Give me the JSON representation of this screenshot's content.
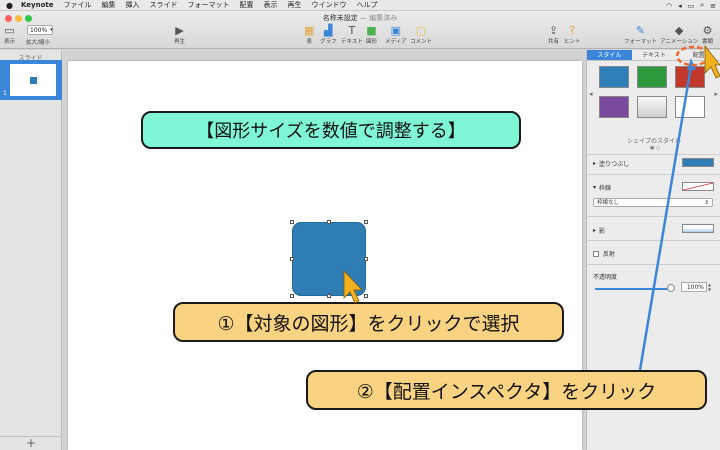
{
  "menubar": {
    "app_name": "Keynote",
    "items": [
      "ファイル",
      "編集",
      "挿入",
      "スライド",
      "フォーマット",
      "配置",
      "表示",
      "再生",
      "ウインドウ",
      "ヘルプ"
    ]
  },
  "toolbar": {
    "doc_title": "名称未設定",
    "doc_status": "— 編集済み",
    "zoom_value": "100%",
    "view_label": "表示",
    "zoom_label": "拡大/縮小",
    "play_label": "再生",
    "table_label": "表",
    "chart_label": "グラフ",
    "text_label": "テキスト",
    "shape_label": "図形",
    "media_label": "メディア",
    "comment_label": "コメント",
    "share_label": "共有",
    "tips_label": "ヒント",
    "format_label": "フォーマット",
    "animation_label": "アニメーション",
    "document_label": "書類"
  },
  "slide_panel": {
    "header": "スライド",
    "slide_number": "1",
    "add_label": "+"
  },
  "callouts": {
    "title": "【図形サイズを数値で調整する】",
    "step1": "①【対象の図形】をクリックで選択",
    "step2": "②【配置インスペクタ】をクリック"
  },
  "inspector": {
    "tabs": [
      "スタイル",
      "テキスト",
      "配置"
    ],
    "shape_style_label": "シェイプのスタイル",
    "fill_label": "塗りつぶし",
    "border_label": "枠線",
    "border_select": "枠線なし",
    "shadow_label": "影",
    "reflection_label": "反射",
    "opacity_label": "不透明度",
    "opacity_value": "100%",
    "swatch_colors": [
      "#2f7fb8",
      "#2e9a3e",
      "#c0392b",
      "#7b4a9e",
      "#e8e8e8",
      "#ffffff"
    ]
  },
  "colors": {
    "shape_fill": "#2e7db5",
    "accent": "#3b86d8",
    "callout_title_bg": "#7ff6d6",
    "callout_step_bg": "#fad382"
  }
}
